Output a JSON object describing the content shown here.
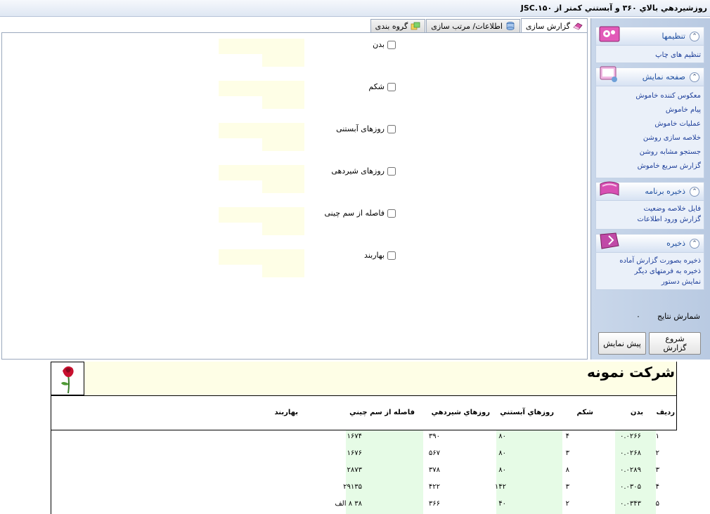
{
  "window": {
    "title": "روزشيردهي بالاي ۳۶۰ و آبستني کمتر از JSC.۱۵۰"
  },
  "tabs": [
    {
      "label": "گزارش سازی",
      "active": true
    },
    {
      "label": "اطلاعات/ مرتب سازی",
      "active": false
    },
    {
      "label": "گروه بندی",
      "active": false
    }
  ],
  "criteria": [
    {
      "label": "بدن"
    },
    {
      "label": "شکم"
    },
    {
      "label": "روزهای آبستنی"
    },
    {
      "label": "روزهای شیردهی"
    },
    {
      "label": "فاصله از سم چینی"
    },
    {
      "label": "بهاربند"
    }
  ],
  "sidebar": {
    "panels": [
      {
        "title": "تنظیمها",
        "items": [
          "تنظیم های چاپ"
        ]
      },
      {
        "title": "صفحه نمایش",
        "items": [
          "معکوس کننده خاموش",
          "پیام خاموش",
          "عملیات خاموش",
          "خلاصه سازی روشن",
          "جستجو مشابه روشن",
          "گزارش سریع خاموش"
        ]
      },
      {
        "title": "ذخیره برنامه",
        "items": [
          "فایل خلاصه وضعیت",
          "گزارش ورود اطلاعات"
        ]
      },
      {
        "title": "ذخیره",
        "items": [
          "ذخیره بصورت گزارش آماده",
          "ذخیره به فرمتهای دیگر",
          "نمایش دستور"
        ]
      }
    ],
    "count_label": "شمارش نتایج",
    "count_value": "۰",
    "start_button": "شروع گزارش",
    "preview_button": "پیش نمایش"
  },
  "report": {
    "company": "شرکت نمونه",
    "columns": [
      "رديف",
      "بدن",
      "شکم",
      "روزهاي آبستني",
      "روزهاي شيردهي",
      "فاصله از سم چيني",
      "بهاربند"
    ],
    "rows": [
      [
        "۱",
        "۰.۰۲۶۶",
        "۴",
        "۸۰",
        "۳۹۰",
        "۱۶۷۴",
        ""
      ],
      [
        "۲",
        "۰.۰۲۶۸",
        "۳",
        "۸۰",
        "۵۶۷",
        "۱۶۷۶",
        ""
      ],
      [
        "۳",
        "۰.۰۲۸۹",
        "۸",
        "۸۰",
        "۳۷۸",
        "۲۸۷۳",
        ""
      ],
      [
        "۴",
        "۰.۰۳۰۵",
        "۳",
        "۱۴۲",
        "۴۲۲",
        "۲۹۱۳۵",
        ""
      ],
      [
        "۵",
        "۰.۰۳۴۳",
        "۲",
        "۴۰",
        "۳۶۶",
        "۳۸ ۸ الف",
        ""
      ]
    ]
  }
}
